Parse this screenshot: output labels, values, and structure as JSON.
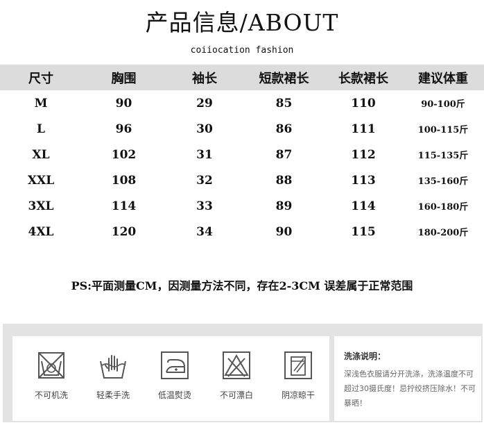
{
  "header": {
    "title": "产品信息/ABOUT",
    "subtitle": "coiiocation fashion"
  },
  "size_table": {
    "headers": [
      "尺寸",
      "胸围",
      "袖长",
      "短款裙长",
      "长款裙长",
      "建议体重"
    ],
    "rows": [
      [
        "M",
        "90",
        "29",
        "85",
        "110",
        "90-100斤"
      ],
      [
        "L",
        "96",
        "30",
        "86",
        "111",
        "100-115斤"
      ],
      [
        "XL",
        "102",
        "31",
        "87",
        "112",
        "115-135斤"
      ],
      [
        "XXL",
        "108",
        "32",
        "88",
        "113",
        "135-160斤"
      ],
      [
        "3XL",
        "114",
        "33",
        "89",
        "114",
        "160-180斤"
      ],
      [
        "4XL",
        "120",
        "34",
        "90",
        "115",
        "180-200斤"
      ]
    ]
  },
  "note": "PS:平面测量CM，因测量方法不同，存在2-3CM 误差属于正常范围",
  "care": {
    "items": [
      {
        "label": "不可机洗",
        "icon": "no-machine-wash-icon"
      },
      {
        "label": "轻柔手洗",
        "icon": "hand-wash-icon"
      },
      {
        "label": "低温熨烫",
        "icon": "low-iron-icon"
      },
      {
        "label": "不可漂白",
        "icon": "no-bleach-icon"
      },
      {
        "label": "阴凉晾干",
        "icon": "shade-dry-icon"
      }
    ],
    "title": "洗涤说明：",
    "text": "深浅色衣服请分开洗涤，洗涤温度不可超过30摄氏度！忌拧绞挤压除水！不可暴晒！"
  },
  "colors": {
    "header_band": "#dcdcdc",
    "care_panel": "#e3e3e3",
    "icon_stroke": "#555555"
  }
}
